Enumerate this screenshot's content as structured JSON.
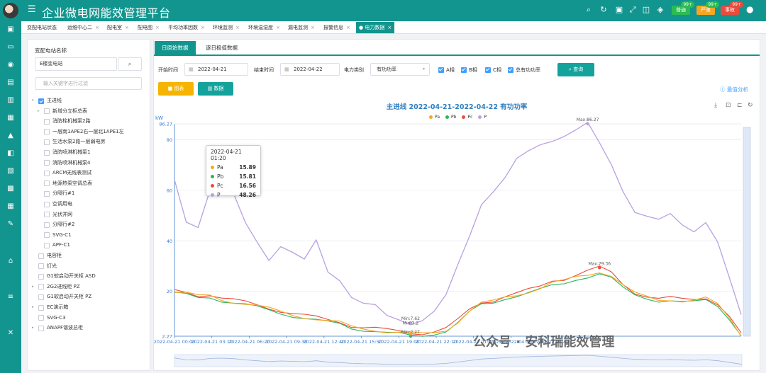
{
  "app": {
    "title": "企业微电网能效管理平台"
  },
  "header_badges": [
    {
      "label": "普通",
      "count": "99+",
      "color": "#2dbb55"
    },
    {
      "label": "严重",
      "count": "99+",
      "color": "#f5a623"
    },
    {
      "label": "事故",
      "count": "99+",
      "color": "#e84c3d"
    }
  ],
  "tabs": [
    {
      "label": "变配电站状态",
      "closable": false
    },
    {
      "label": "运维中心二",
      "closable": true
    },
    {
      "label": "配电室",
      "closable": true
    },
    {
      "label": "配电图",
      "closable": true
    },
    {
      "label": "平均功率因数",
      "closable": true
    },
    {
      "label": "环境监测",
      "closable": true
    },
    {
      "label": "环境温湿度",
      "closable": true
    },
    {
      "label": "漏电监测",
      "closable": true
    },
    {
      "label": "报警信息",
      "closable": true
    },
    {
      "label": "电力数据",
      "closable": true,
      "active": true
    }
  ],
  "tree": {
    "section_label": "变配电站名称",
    "station_value": "E楼变电站",
    "filter_placeholder": "输入关键字进行过滤",
    "items": [
      {
        "label": "主进线",
        "level": 0,
        "arrow": "▾",
        "checked": true
      },
      {
        "label": "新增分立柜总表",
        "level": 1,
        "arrow": "▸",
        "checked": false
      },
      {
        "label": "消防栓机械泵2路",
        "level": 1,
        "arrow": "",
        "checked": false
      },
      {
        "label": "一层南1APE2右一层北1APE1左",
        "level": 1,
        "arrow": "",
        "checked": false
      },
      {
        "label": "生活水泵2路一层弱电房",
        "level": 1,
        "arrow": "",
        "checked": false
      },
      {
        "label": "消防喷淋机械泵1",
        "level": 1,
        "arrow": "",
        "checked": false
      },
      {
        "label": "消防喷淋机械泵4",
        "level": 1,
        "arrow": "",
        "checked": false
      },
      {
        "label": "ARCM无线表测试",
        "level": 1,
        "arrow": "",
        "checked": false
      },
      {
        "label": "地源热泵空调总表",
        "level": 1,
        "arrow": "",
        "checked": false
      },
      {
        "label": "分隔行#1",
        "level": 1,
        "arrow": "",
        "checked": false
      },
      {
        "label": "空调用电",
        "level": 1,
        "arrow": "",
        "checked": false
      },
      {
        "label": "光伏并网",
        "level": 1,
        "arrow": "",
        "checked": false
      },
      {
        "label": "分隔行#2",
        "level": 1,
        "arrow": "",
        "checked": false
      },
      {
        "label": "SVG-C1",
        "level": 1,
        "arrow": "",
        "checked": false
      },
      {
        "label": "APF-C1",
        "level": 1,
        "arrow": "",
        "checked": false
      },
      {
        "label": "电容柜",
        "level": 0,
        "arrow": "",
        "checked": false
      },
      {
        "label": "灯光",
        "level": 0,
        "arrow": "",
        "checked": false
      },
      {
        "label": "G1软启动开关柜 ASD",
        "level": 0,
        "arrow": "",
        "checked": false
      },
      {
        "label": "2G2进线柜 PZ",
        "level": 0,
        "arrow": "▸",
        "checked": false
      },
      {
        "label": "G1软启动开关柜 PZ",
        "level": 0,
        "arrow": "",
        "checked": false
      },
      {
        "label": "EC演示箱",
        "level": 0,
        "arrow": "▸",
        "checked": false
      },
      {
        "label": "SVG-C3",
        "level": 0,
        "arrow": "",
        "checked": false
      },
      {
        "label": "ANAPF谐波总柜",
        "level": 0,
        "arrow": "▸",
        "checked": false
      }
    ]
  },
  "subtabs": [
    {
      "label": "日原始数据",
      "active": true
    },
    {
      "label": "逐日极值数据",
      "active": false
    }
  ],
  "filters": {
    "start_label": "开始时间",
    "start_value": "2022-04-21",
    "end_label": "结束时间",
    "end_value": "2022-04-22",
    "type_label": "电力类别",
    "type_value": "有功功率",
    "checks": [
      "A相",
      "B相",
      "C相",
      "总有功功率"
    ],
    "query_label": "查询"
  },
  "view_buttons": {
    "chart": "图表",
    "data": "数据"
  },
  "best_analysis": "最值分析",
  "chart_data": {
    "type": "line",
    "title": "主进线  2022-04-21-2022-04-22  有功功率",
    "ylabel": "kW",
    "ylim": [
      2.27,
      86.27
    ],
    "yticks": [
      "86.27",
      "80",
      "60",
      "40",
      "20",
      "2.27"
    ],
    "xticks": [
      "2022-04-21 00:00",
      "2022-04-21 03:10",
      "2022-04-21 06:20",
      "2022-04-21 09:30",
      "2022-04-21 12:40",
      "2022-04-21 15:50",
      "2022-04-21 19:00",
      "2022-04-21 22:10",
      "2022-04-22 01:20",
      "2022-04-22 04:30",
      "2022-04-22 07:40"
    ],
    "x_hours": [
      0,
      1,
      2,
      3,
      4,
      5,
      6,
      7,
      8,
      9,
      10,
      11,
      12,
      13,
      14,
      15,
      16,
      17,
      18,
      19,
      20,
      21,
      22,
      23,
      24,
      25,
      26,
      27,
      28,
      29,
      30,
      31,
      32,
      33,
      34,
      35,
      36,
      37,
      38,
      39,
      40,
      41,
      42,
      43,
      44,
      45,
      46,
      47,
      48
    ],
    "legend_position": "top-center",
    "series": [
      {
        "name": "Pa",
        "color": "#f5a623",
        "values": [
          19.5,
          19,
          18,
          18.5,
          17,
          16,
          15,
          14,
          13,
          12,
          11,
          10,
          9,
          8,
          7.5,
          6,
          5.5,
          5,
          4,
          3.5,
          3.2,
          3.2,
          4,
          5,
          8,
          12,
          15,
          16,
          18,
          19,
          20,
          21,
          23,
          24,
          26,
          27,
          28,
          26,
          22,
          19,
          18,
          17,
          17,
          16,
          16,
          17,
          15,
          10,
          3
        ]
      },
      {
        "name": "Pb",
        "color": "#2bb55a",
        "values": [
          19,
          18.5,
          17.5,
          18,
          16.5,
          15.5,
          14.5,
          13.5,
          12.5,
          11.5,
          10.5,
          9.5,
          8.5,
          7.5,
          7,
          5.5,
          5,
          4.5,
          3.5,
          3,
          2.27,
          2.5,
          3.5,
          4.5,
          7.5,
          11.5,
          14.5,
          15.5,
          17.5,
          18.5,
          19.5,
          20.5,
          22,
          23,
          25,
          26,
          27,
          25,
          21,
          18.5,
          17.5,
          16.5,
          16.5,
          15.5,
          15.5,
          16.5,
          14.5,
          9.5,
          2.8
        ]
      },
      {
        "name": "Pc",
        "color": "#e84c3d",
        "values": [
          20,
          19.5,
          18.5,
          19,
          17.5,
          16.5,
          15.5,
          14.5,
          13.5,
          12.5,
          11.5,
          10.5,
          9.5,
          8.5,
          8,
          6.5,
          6,
          5.5,
          4.5,
          4,
          3.5,
          3.6,
          4.5,
          5.5,
          8.5,
          12.5,
          15.5,
          16.5,
          18.5,
          19.5,
          20.5,
          21.5,
          24,
          25,
          27,
          28.5,
          29.36,
          27,
          22.5,
          19.5,
          18.5,
          17.5,
          17.5,
          16.5,
          16.5,
          17.5,
          15.5,
          10.5,
          3.2
        ]
      },
      {
        "name": "P",
        "color": "#b7a1e0",
        "values": [
          64,
          48,
          46,
          60,
          62,
          58,
          47,
          40,
          33,
          38,
          35,
          32,
          40,
          28,
          25,
          18,
          15,
          14,
          10,
          9,
          7.62,
          9,
          12,
          18,
          30,
          42,
          55,
          60,
          65,
          72,
          75,
          78,
          80,
          82,
          84,
          86.27,
          78,
          70,
          60,
          52,
          50,
          48,
          50,
          46,
          44,
          48,
          40,
          25,
          10
        ]
      }
    ],
    "markers": [
      {
        "label": "Max:86.27"
      },
      {
        "label": "Max:29.36"
      },
      {
        "label": "Min:7.62"
      },
      {
        "label": "Min:2.27"
      },
      {
        "label": "Min:3.2"
      }
    ],
    "tooltip": {
      "time": "2022-04-21 01:20",
      "rows": [
        {
          "name": "Pa",
          "value": "15.89",
          "color": "#f5a623"
        },
        {
          "name": "Pb",
          "value": "15.81",
          "color": "#2bb55a"
        },
        {
          "name": "Pc",
          "value": "16.56",
          "color": "#e84c3d"
        },
        {
          "name": "P",
          "value": "48.26",
          "color": "#b7a1e0"
        }
      ]
    }
  },
  "watermark": "公众号 · 安科瑞能效管理",
  "icons": [
    "menu-icon",
    "search-icon",
    "refresh-icon",
    "save-icon",
    "expand-icon",
    "skin-icon",
    "theme-icon",
    "user-icon",
    "calendar-icon",
    "dropdown-icon",
    "search-icon",
    "download-icon",
    "zoom-icon",
    "restore-icon",
    "reset-icon"
  ],
  "colors": {
    "accent": "#13958f",
    "link": "#409eff",
    "chart_btn": "#f5b400",
    "data_btn": "#13a39c"
  }
}
